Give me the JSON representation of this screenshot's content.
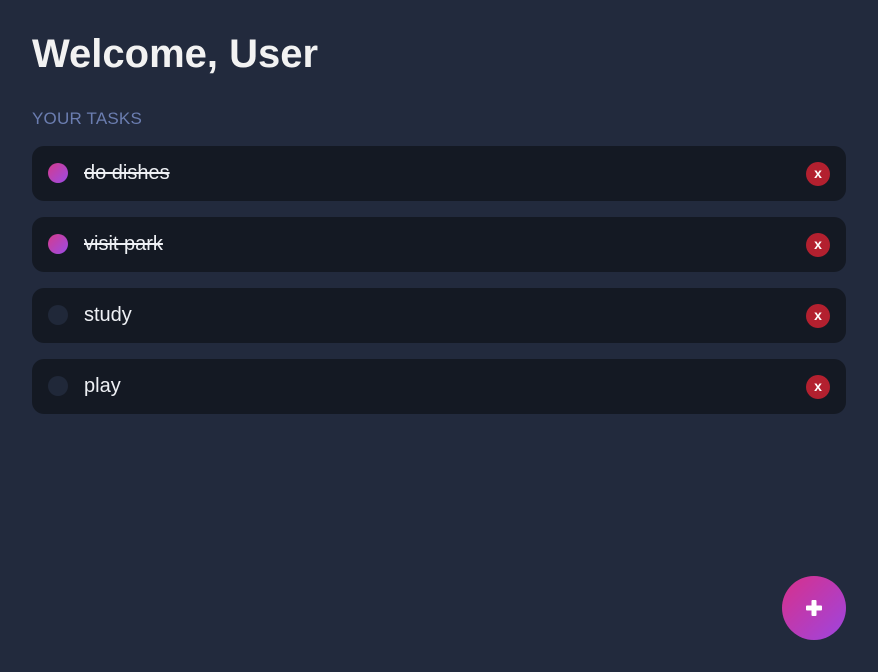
{
  "header": {
    "title": "Welcome, User"
  },
  "tasks_section": {
    "label": "YOUR TASKS"
  },
  "tasks": [
    {
      "text": "do dishes",
      "completed": true,
      "delete_label": "x"
    },
    {
      "text": "visit park",
      "completed": true,
      "delete_label": "x"
    },
    {
      "text": "study",
      "completed": false,
      "delete_label": "x"
    },
    {
      "text": "play",
      "completed": false,
      "delete_label": "x"
    }
  ],
  "add_button": {
    "icon": "plus-icon"
  },
  "colors": {
    "background": "#222a3d",
    "card": "#141923",
    "accent_start": "#d8308a",
    "accent_end": "#9d45e0",
    "delete": "#b3202f",
    "section_label": "#6b7db0"
  }
}
